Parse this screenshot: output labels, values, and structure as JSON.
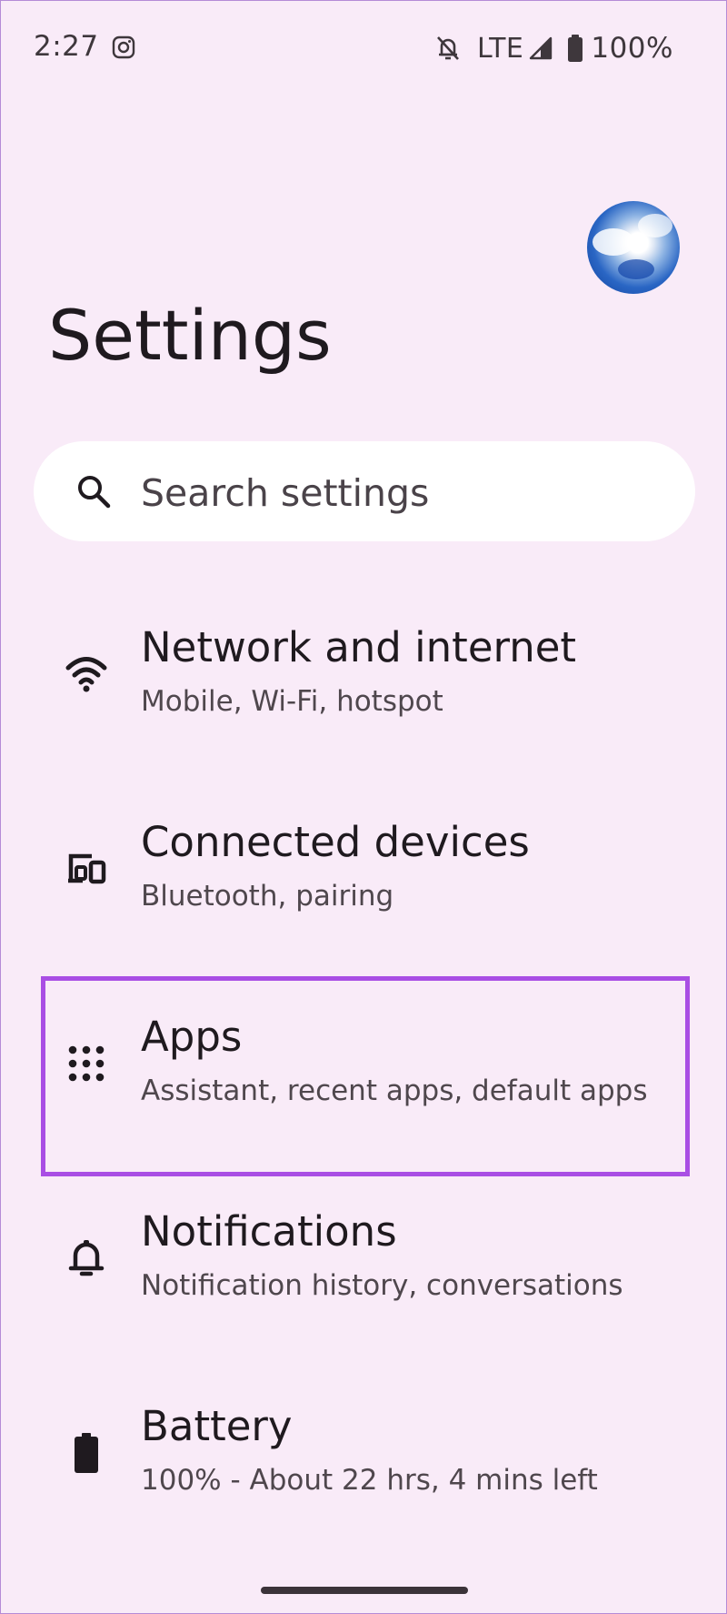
{
  "status_bar": {
    "time": "2:27",
    "network": "LTE",
    "battery": "100%",
    "icons": [
      "instagram-icon",
      "notifications-off-icon",
      "signal-icon",
      "battery-icon"
    ]
  },
  "header": {
    "title": "Settings"
  },
  "search": {
    "placeholder": "Search settings"
  },
  "items": [
    {
      "title": "Network and internet",
      "subtitle": "Mobile, Wi-Fi, hotspot",
      "icon": "wifi-icon"
    },
    {
      "title": "Connected devices",
      "subtitle": "Bluetooth, pairing",
      "icon": "devices-icon"
    },
    {
      "title": "Apps",
      "subtitle": "Assistant, recent apps, default apps",
      "icon": "apps-grid-icon",
      "highlighted": true
    },
    {
      "title": "Notifications",
      "subtitle": "Notification history, conversations",
      "icon": "bell-icon"
    },
    {
      "title": "Battery",
      "subtitle": "100% - About 22 hrs, 4 mins left",
      "icon": "battery-icon"
    }
  ],
  "colors": {
    "background": "#f9ebf8",
    "highlight": "#a94ee4",
    "text_primary": "#1f1a1f",
    "text_secondary": "#4f474d",
    "search_background": "#ffffff"
  }
}
